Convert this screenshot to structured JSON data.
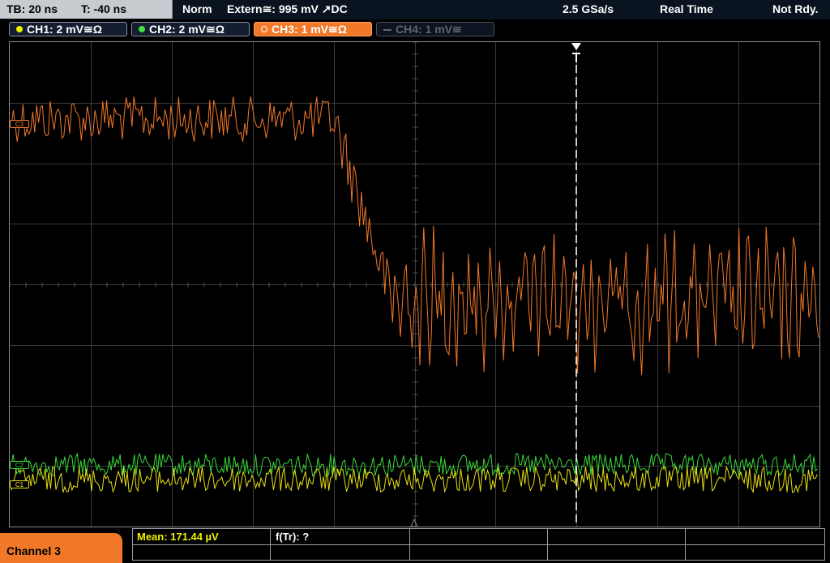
{
  "status": {
    "timebase": "TB: 20 ns",
    "trigger_time": "T: -40 ns",
    "trigger_mode": "Norm",
    "trigger_source": "Extern≅: 995 mV ↗DC",
    "sample_rate": "2.5 GSa/s",
    "acq_mode": "Real Time",
    "run_state": "Not Rdy."
  },
  "channels": [
    {
      "label": "CH1: 2 mV≅Ω",
      "color": "#f0f000",
      "state": "on"
    },
    {
      "label": "CH2: 2 mV≅Ω",
      "color": "#40e040",
      "state": "on"
    },
    {
      "label": "CH3: 1 mV≅Ω",
      "color": "#f07828",
      "state": "active"
    },
    {
      "label": "CH4: 1 mV≅",
      "color": "#5e6470",
      "state": "off"
    }
  ],
  "traces": {
    "ch1_color": "#e8e010",
    "ch2_color": "#38d838",
    "ch3_color": "#f07828"
  },
  "markers": {
    "trigger_label": "T",
    "ch3_level": "C3",
    "ch2_level": "C2",
    "ch1_level": "C1"
  },
  "bottom": {
    "channel_label": "Channel 3",
    "mean_label": "Mean: 171.44 µV",
    "ftr_label": "f(Tr): ?"
  }
}
